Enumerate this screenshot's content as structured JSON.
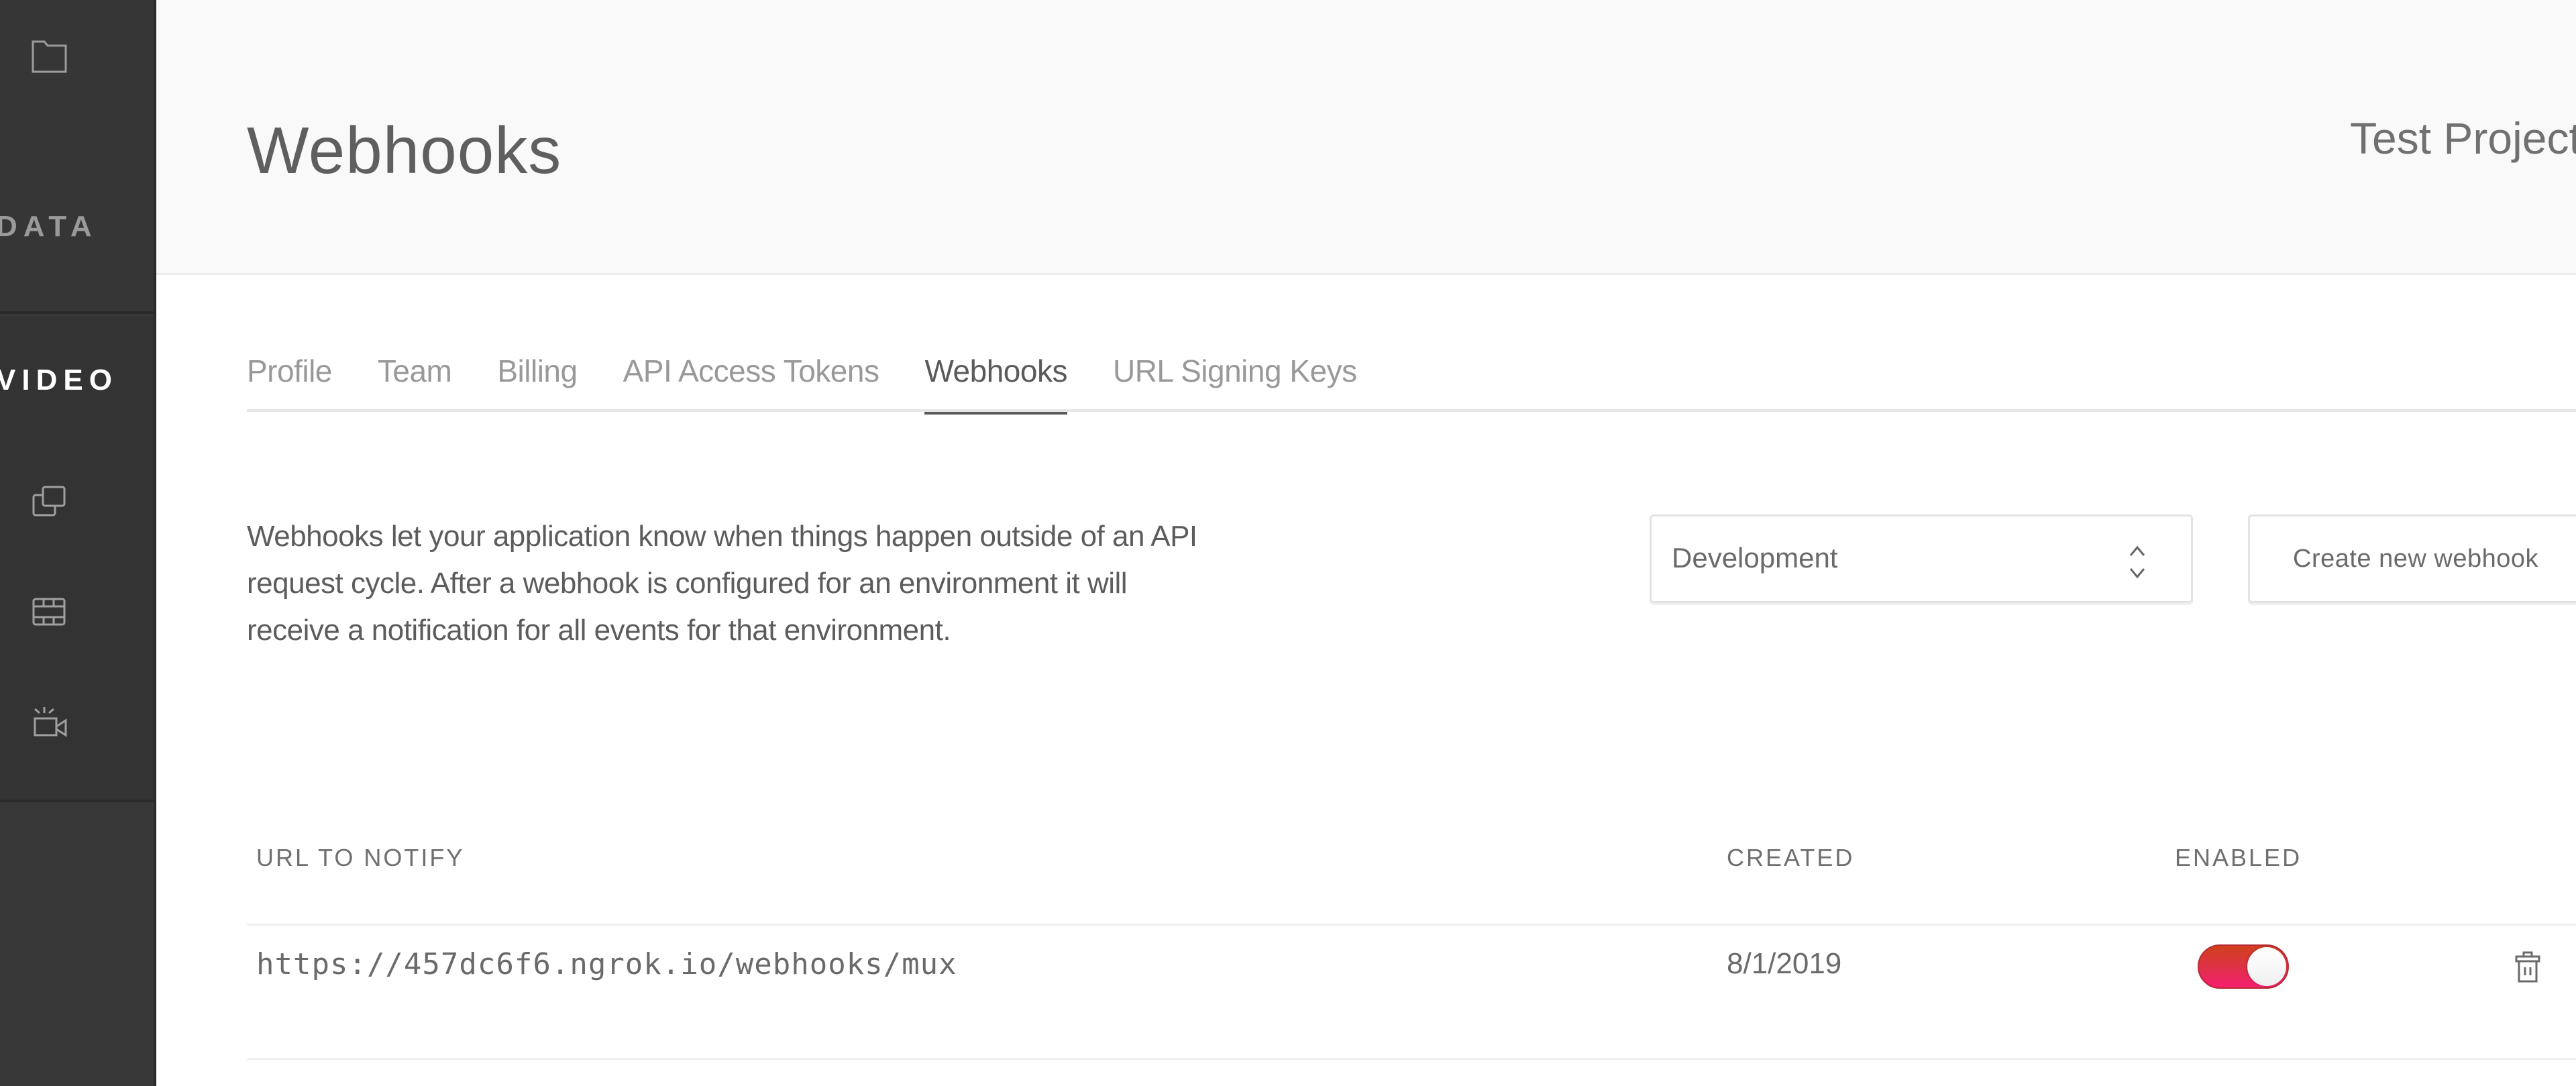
{
  "sidebar": {
    "top_icon": "folder-icon",
    "data_label": "DATA",
    "video_label": "VIDEO",
    "video_items": [
      {
        "icon": "assets-icon"
      },
      {
        "icon": "film-strip-icon"
      },
      {
        "icon": "live-camera-icon"
      }
    ]
  },
  "header": {
    "title": "Webhooks",
    "project_name": "Test Project"
  },
  "tabs": [
    {
      "label": "Profile",
      "active": false
    },
    {
      "label": "Team",
      "active": false
    },
    {
      "label": "Billing",
      "active": false
    },
    {
      "label": "API Access Tokens",
      "active": false
    },
    {
      "label": "Webhooks",
      "active": true
    },
    {
      "label": "URL Signing Keys",
      "active": false
    }
  ],
  "description": "Webhooks let your application know when things happen outside of an API request cycle. After a webhook is configured for an environment it will receive a notification for all events for that environment.",
  "environment_select": {
    "value": "Development"
  },
  "create_button": {
    "label": "Create new webhook"
  },
  "table": {
    "headers": {
      "url": "URL TO NOTIFY",
      "created": "CREATED",
      "enabled": "ENABLED"
    },
    "rows": [
      {
        "url": "https://457dc6f6.ngrok.io/webhooks/mux",
        "created": "8/1/2019",
        "enabled": true
      }
    ]
  },
  "colors": {
    "sidebar_bg": "#383838",
    "header_bg": "#f9f9f9",
    "toggle_on_top": "#d0401c",
    "toggle_on_bottom": "#f61f70",
    "text_primary": "#5f5f5f",
    "text_muted": "#999999"
  }
}
